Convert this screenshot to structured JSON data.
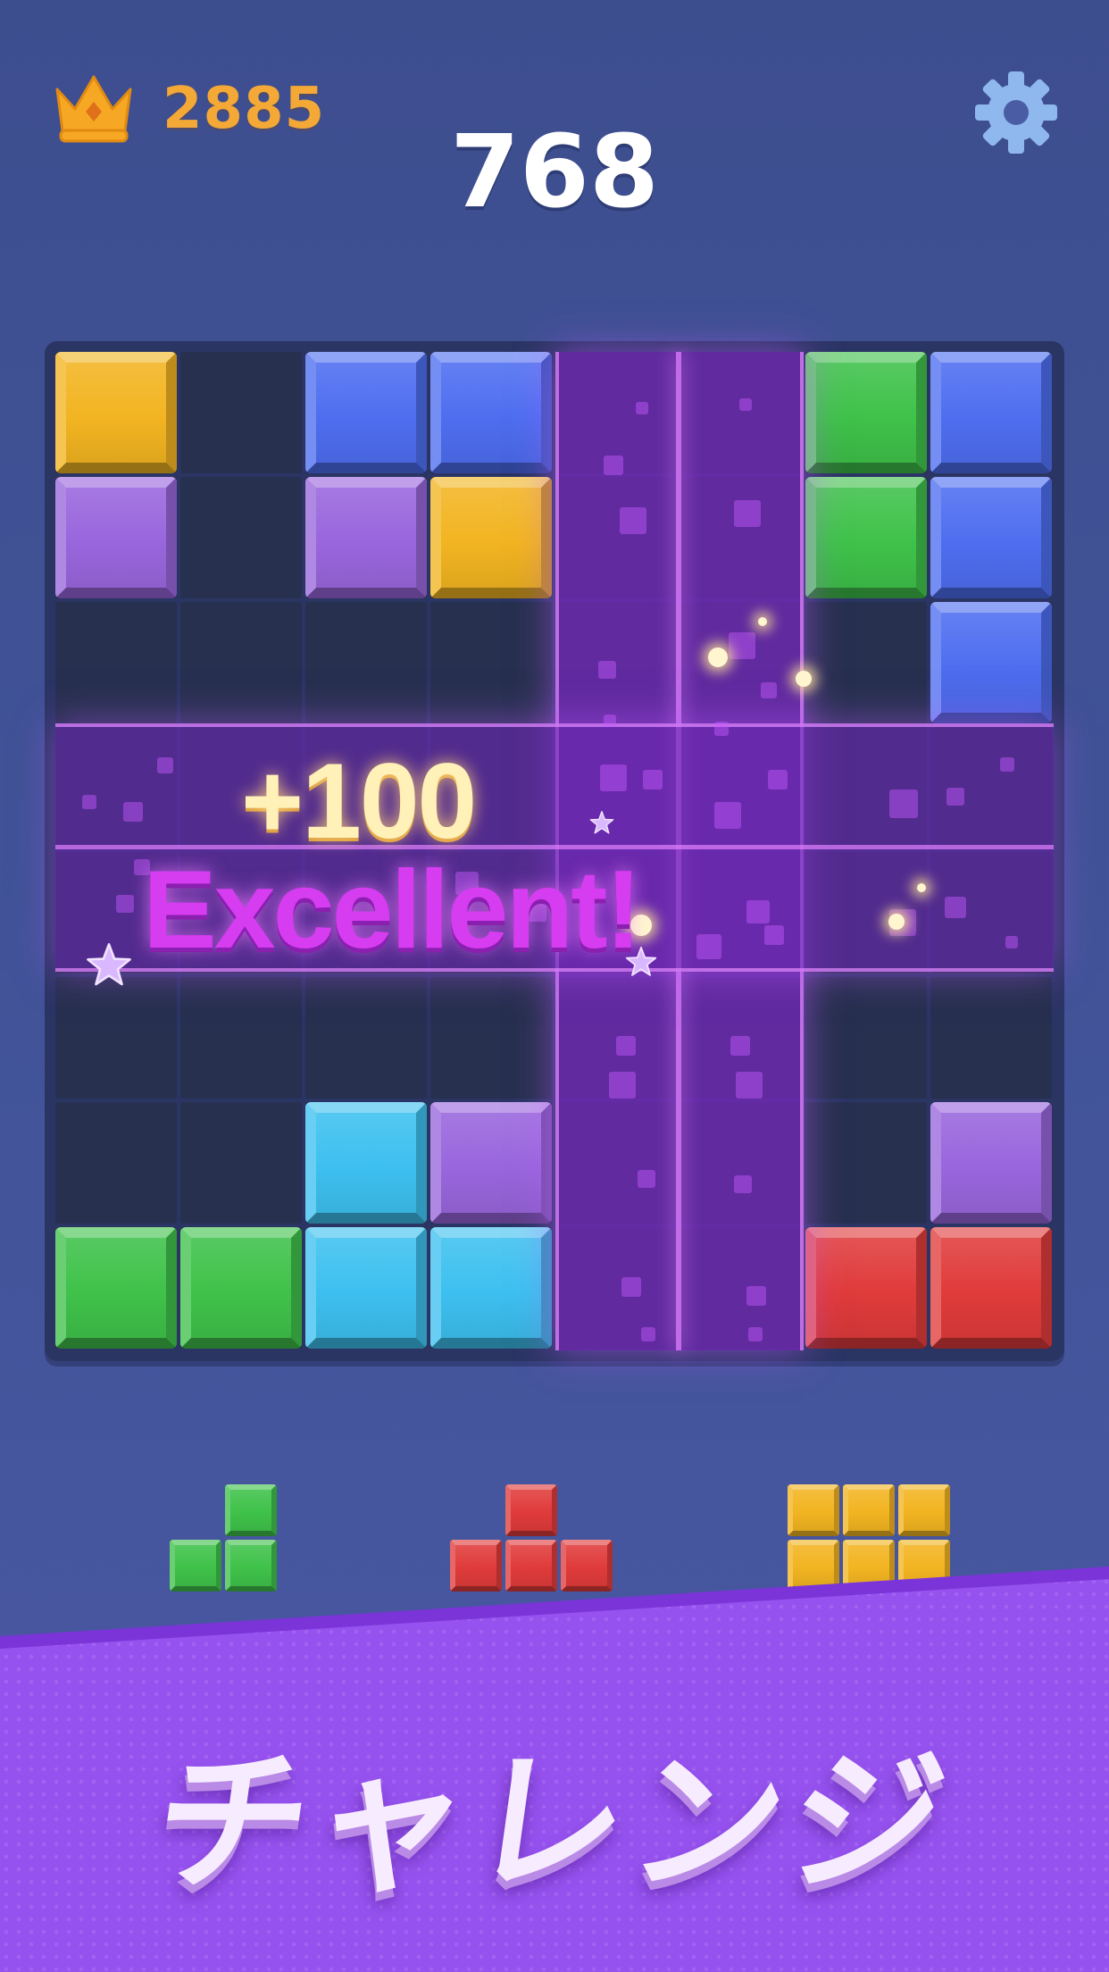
{
  "hud": {
    "best_score": "2885",
    "score": "768",
    "best_icon": "crown-icon",
    "settings_icon": "gear-icon"
  },
  "colors": {
    "yellow": "#f2b421",
    "blue": "#4e6ef0",
    "purple": "#9966dd",
    "green": "#3fc24a",
    "cyan": "#3dc0ef",
    "red": "#e03b3b",
    "empty": "#27304f",
    "clear_fx": "#7a2cc0"
  },
  "board": {
    "size": 8,
    "grid": [
      [
        "yellow",
        "",
        "blue",
        "blue",
        "",
        "",
        "green",
        "blue"
      ],
      [
        "purple",
        "",
        "purple",
        "yellow",
        "",
        "",
        "green",
        "blue"
      ],
      [
        "",
        "",
        "",
        "",
        "",
        "",
        "",
        "blue"
      ],
      [
        "",
        "",
        "",
        "",
        "",
        "",
        "",
        ""
      ],
      [
        "",
        "",
        "",
        "",
        "",
        "",
        "",
        ""
      ],
      [
        "",
        "",
        "",
        "",
        "",
        "",
        "",
        ""
      ],
      [
        "",
        "",
        "cyan",
        "purple",
        "",
        "",
        "",
        "purple"
      ],
      [
        "green",
        "green",
        "cyan",
        "cyan",
        "",
        "",
        "red",
        "red"
      ]
    ],
    "cleared_rows": [
      3,
      4
    ],
    "cleared_cols": [
      4,
      5
    ]
  },
  "combo": {
    "points": "+100",
    "message": "Excellent!"
  },
  "tray": [
    {
      "color": "green",
      "cells": [
        [
          0,
          1
        ],
        [
          1,
          0
        ],
        [
          1,
          1
        ]
      ]
    },
    {
      "color": "red",
      "cells": [
        [
          0,
          1
        ],
        [
          1,
          0
        ],
        [
          1,
          1
        ],
        [
          1,
          2
        ]
      ]
    },
    {
      "color": "yellow",
      "cells": [
        [
          0,
          0
        ],
        [
          0,
          1
        ],
        [
          0,
          2
        ],
        [
          1,
          0
        ],
        [
          1,
          1
        ],
        [
          1,
          2
        ]
      ]
    }
  ],
  "banner": {
    "title": "チャレンジ"
  }
}
